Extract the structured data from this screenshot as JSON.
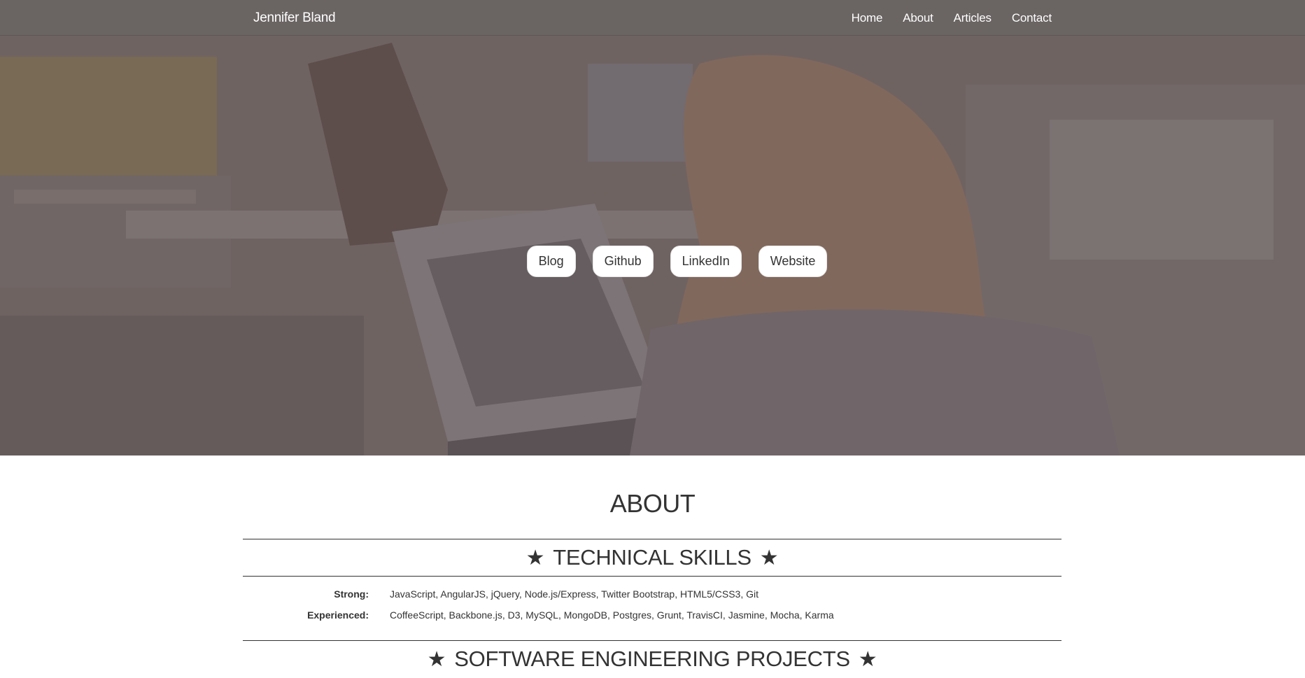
{
  "navbar": {
    "brand": "Jennifer Bland",
    "links": [
      {
        "label": "Home"
      },
      {
        "label": "About"
      },
      {
        "label": "Articles"
      },
      {
        "label": "Contact"
      }
    ]
  },
  "hero": {
    "buttons": [
      {
        "label": "Blog"
      },
      {
        "label": "Github"
      },
      {
        "label": "LinkedIn"
      },
      {
        "label": "Website"
      }
    ]
  },
  "about": {
    "title": "ABOUT",
    "skills_heading": "TECHNICAL SKILLS",
    "skills": [
      {
        "label": "Strong:",
        "value": "JavaScript, AngularJS, jQuery, Node.js/Express, Twitter Bootstrap, HTML5/CSS3, Git"
      },
      {
        "label": "Experienced:",
        "value": "CoffeeScript, Backbone.js, D3, MySQL, MongoDB, Postgres, Grunt, TravisCI, Jasmine, Mocha, Karma"
      }
    ],
    "projects_heading": "SOFTWARE ENGINEERING PROJECTS"
  },
  "icons": {
    "heading_star": "★"
  },
  "colors": {
    "navbar_bg": "#6a6463",
    "hero_tint": "#6f6462",
    "text": "#333333"
  }
}
